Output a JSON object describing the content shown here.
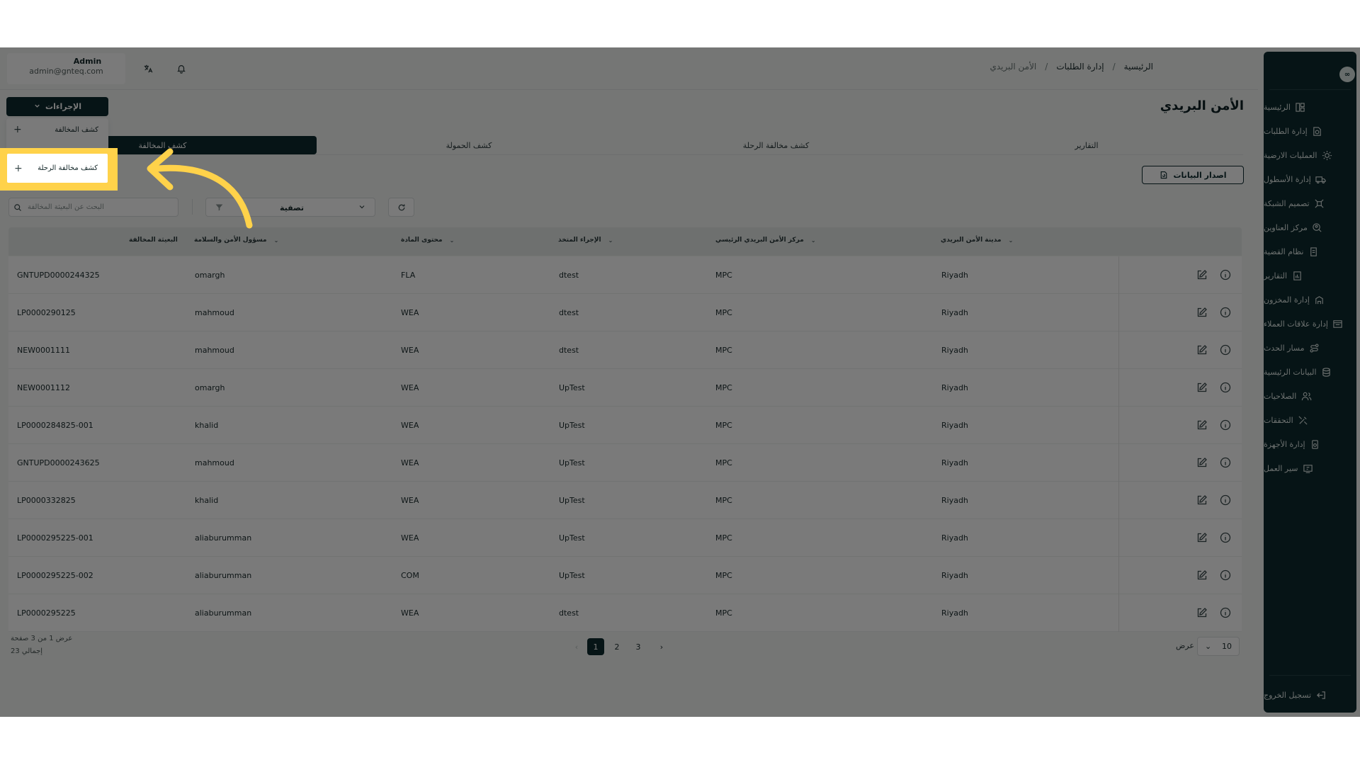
{
  "user": {
    "name": "Admin",
    "email": "admin@gnteq.com"
  },
  "breadcrumb": {
    "home": "الرئيسية",
    "section": "إدارة الطلبات",
    "current": "الأمن البريدي"
  },
  "page_title": "الأمن البريدي",
  "actions": {
    "label": "الإجراءات",
    "items": [
      "كشف المخالفة",
      "كشف مخالفة الرحلة"
    ]
  },
  "tabs": [
    "التقارير",
    "كشف مخالفة الرحلة",
    "كشف الحمولة",
    "كشف المخالفة"
  ],
  "release_button": "اصدار البيانات",
  "search": {
    "placeholder": "البحث عن البعيثة المخالفة"
  },
  "filter": {
    "label": "تصفية"
  },
  "sidebar": {
    "logo": "∞",
    "items": [
      {
        "label": "الرئيسية",
        "icon": "dashboard-icon"
      },
      {
        "label": "إدارة الطلبات",
        "icon": "orders-icon"
      },
      {
        "label": "العمليات الارضية",
        "icon": "ground-ops-icon"
      },
      {
        "label": "إدارة الأسطول",
        "icon": "truck-icon"
      },
      {
        "label": "تصميم الشبكة",
        "icon": "network-icon"
      },
      {
        "label": "مركز العناوين",
        "icon": "address-icon"
      },
      {
        "label": "نظام القضية",
        "icon": "case-icon"
      },
      {
        "label": "التقارير",
        "icon": "report-icon"
      },
      {
        "label": "إدارة المخزون",
        "icon": "inventory-icon"
      },
      {
        "label": "إدارة علاقات العملاء",
        "icon": "crm-icon"
      },
      {
        "label": "مسار الحدث",
        "icon": "route-icon"
      },
      {
        "label": "البيانات الرئيسية",
        "icon": "database-icon"
      },
      {
        "label": "الصلاحيات",
        "icon": "users-icon"
      },
      {
        "label": "التحققات",
        "icon": "tools-icon"
      },
      {
        "label": "إدارة الأجهزة",
        "icon": "device-icon"
      },
      {
        "label": "سير العمل",
        "icon": "workflow-icon"
      }
    ],
    "logout": "تسجيل الخروج"
  },
  "table": {
    "headers": {
      "shipment": "البعيثة المخالفة",
      "officer": "مسؤول الأمن والسلامة",
      "content": "محتوى المادة",
      "action": "الإجراء المتخذ",
      "center": "مركز الأمن البريدي الرئيسي",
      "city": "مدينة الأمن البريدي"
    },
    "rows": [
      {
        "shipment": "GNTUPD0000244325",
        "officer": "omargh",
        "content": "FLA",
        "action": "dtest",
        "center": "MPC",
        "city": "Riyadh"
      },
      {
        "shipment": "LP0000290125",
        "officer": "mahmoud",
        "content": "WEA",
        "action": "dtest",
        "center": "MPC",
        "city": "Riyadh"
      },
      {
        "shipment": "NEW0001111",
        "officer": "mahmoud",
        "content": "WEA",
        "action": "dtest",
        "center": "MPC",
        "city": "Riyadh"
      },
      {
        "shipment": "NEW0001112",
        "officer": "omargh",
        "content": "WEA",
        "action": "UpTest",
        "center": "MPC",
        "city": "Riyadh"
      },
      {
        "shipment": "LP0000284825-001",
        "officer": "khalid",
        "content": "WEA",
        "action": "UpTest",
        "center": "MPC",
        "city": "Riyadh"
      },
      {
        "shipment": "GNTUPD0000243625",
        "officer": "mahmoud",
        "content": "WEA",
        "action": "UpTest",
        "center": "MPC",
        "city": "Riyadh"
      },
      {
        "shipment": "LP0000332825",
        "officer": "khalid",
        "content": "WEA",
        "action": "UpTest",
        "center": "MPC",
        "city": "Riyadh"
      },
      {
        "shipment": "LP0000295225-001",
        "officer": "aliaburumman",
        "content": "WEA",
        "action": "UpTest",
        "center": "MPC",
        "city": "Riyadh"
      },
      {
        "shipment": "LP0000295225-002",
        "officer": "aliaburumman",
        "content": "COM",
        "action": "UpTest",
        "center": "MPC",
        "city": "Riyadh"
      },
      {
        "shipment": "LP0000295225",
        "officer": "aliaburumman",
        "content": "WEA",
        "action": "dtest",
        "center": "MPC",
        "city": "Riyadh"
      }
    ]
  },
  "pagination": {
    "info": "عرض 1 من 3 صفحة",
    "total": "إجمالي 23",
    "pages": [
      "1",
      "2",
      "3"
    ],
    "current": "1",
    "page_size_label": "عرض",
    "page_size": "10"
  },
  "colors": {
    "primary": "#0e2b2e",
    "highlight": "#ffd24a"
  }
}
